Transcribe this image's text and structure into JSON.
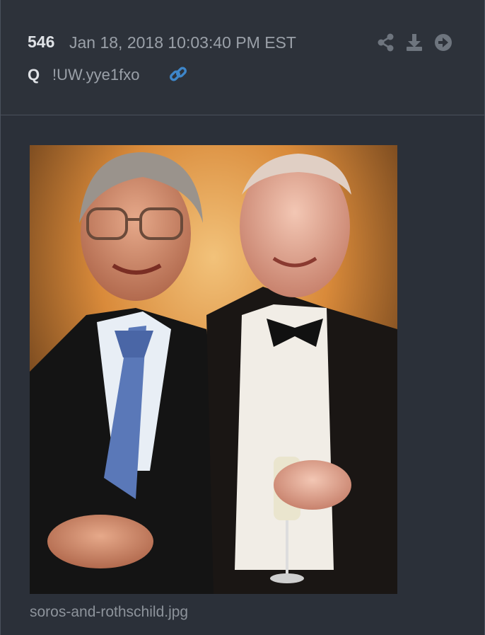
{
  "post": {
    "number": "546",
    "datetime": "Jan 18, 2018 10:03:40 PM EST",
    "author": "Q",
    "tripcode": "!UW.yye1fxo"
  },
  "icons": {
    "link": "link-icon",
    "share": "share-icon",
    "download": "download-icon",
    "next": "arrow-circle-right-icon"
  },
  "attachment": {
    "filename": "soros-and-rothschild.jpg"
  },
  "colors": {
    "background": "#2b3039",
    "header": "#2d323a",
    "link_accent": "#3e86c9",
    "muted_text": "#9aa0a8"
  }
}
